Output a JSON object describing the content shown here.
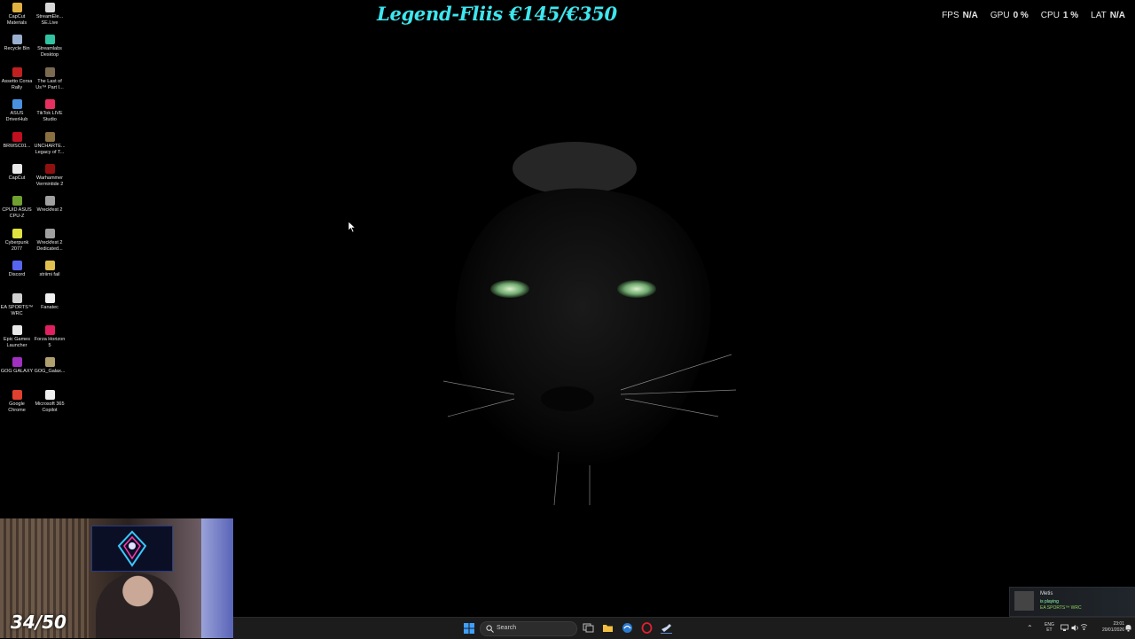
{
  "overlay": {
    "donation_goal": "Legend-Fliis €145/€350",
    "counter": "34/50",
    "perf": [
      {
        "label": "FPS",
        "value": "N/A"
      },
      {
        "label": "GPU",
        "value": "0 %"
      },
      {
        "label": "CPU",
        "value": "1 %"
      },
      {
        "label": "LAT",
        "value": "N/A"
      }
    ]
  },
  "desktop_icons": [
    {
      "label": "CapCut Materials",
      "icon": "folder-icon",
      "color": "#e0b040"
    },
    {
      "label": "StreamEle... SE.Live",
      "icon": "streamelements-icon",
      "color": "#d8d8d8"
    },
    {
      "label": "Recycle Bin",
      "icon": "recycle-bin-icon",
      "color": "#9ab0d0"
    },
    {
      "label": "Streamlabs Desktop",
      "icon": "streamlabs-icon",
      "color": "#31c3a2"
    },
    {
      "label": "Assetto Corsa Rally",
      "icon": "assetto-corsa-icon",
      "color": "#c02020"
    },
    {
      "label": "The Last of Us™ Part I...",
      "icon": "last-of-us-icon",
      "color": "#7a6a50"
    },
    {
      "label": "ASUS DriverHub",
      "icon": "asus-driverhub-icon",
      "color": "#4a90e0"
    },
    {
      "label": "TikTok LIVE Studio",
      "icon": "tiktok-icon",
      "color": "#e83060"
    },
    {
      "label": "BRWSC01...",
      "icon": "opera-icon",
      "color": "#c01020"
    },
    {
      "label": "UNCHARTE... Legacy of T...",
      "icon": "uncharted-icon",
      "color": "#8a7040"
    },
    {
      "label": "CapCut",
      "icon": "capcut-icon",
      "color": "#e8e8e8"
    },
    {
      "label": "Warhammer Vermintide 2",
      "icon": "warhammer-icon",
      "color": "#901010"
    },
    {
      "label": "CPUID ASUS CPU-Z",
      "icon": "cpuz-icon",
      "color": "#70a030"
    },
    {
      "label": "Wreckfest 2",
      "icon": "wreckfest-icon",
      "color": "#a0a0a0"
    },
    {
      "label": "Cyberpunk 2077",
      "icon": "cyberpunk-icon",
      "color": "#e0e040"
    },
    {
      "label": "Wreckfest 2 Dedicated...",
      "icon": "wreckfest-server-icon",
      "color": "#a0a0a0"
    },
    {
      "label": "Discord",
      "icon": "discord-icon",
      "color": "#5865f2"
    },
    {
      "label": "striimi fail",
      "icon": "folder-icon",
      "color": "#e0c050"
    },
    {
      "label": "EA SPORTS™ WRC",
      "icon": "ea-wrc-icon",
      "color": "#d0d0d0"
    },
    {
      "label": "Fanatec",
      "icon": "fanatec-icon",
      "color": "#f0f0f0"
    },
    {
      "label": "Epic Games Launcher",
      "icon": "epic-games-icon",
      "color": "#e8e8e8"
    },
    {
      "label": "Forza Horizon 5",
      "icon": "forza-icon",
      "color": "#e02060"
    },
    {
      "label": "GOG GALAXY",
      "icon": "gog-galaxy-icon",
      "color": "#a030c0"
    },
    {
      "label": "GOG_Galax...",
      "icon": "gog-galaxy-2-icon",
      "color": "#b0a070"
    },
    {
      "label": "Google Chrome",
      "icon": "chrome-icon",
      "color": "#e04030"
    },
    {
      "label": "Microsoft 365 Copilot",
      "icon": "document-icon",
      "color": "#f0f0f0"
    }
  ],
  "notification": {
    "name": "Metis",
    "status": "is playing",
    "game": "EA SPORTS™ WRC"
  },
  "taskbar": {
    "search_placeholder": "Search",
    "apps": [
      "task-view-icon",
      "file-explorer-icon",
      "browser-icon",
      "opera-icon",
      "steam-icon"
    ],
    "language": "ENG",
    "layout": "ET",
    "time": "23:01",
    "date": "20/01/2026"
  },
  "colors": {
    "goal_text": "#3ee6ee",
    "taskbar_bg": "#1c1c1c",
    "desktop_bg": "#000000"
  }
}
